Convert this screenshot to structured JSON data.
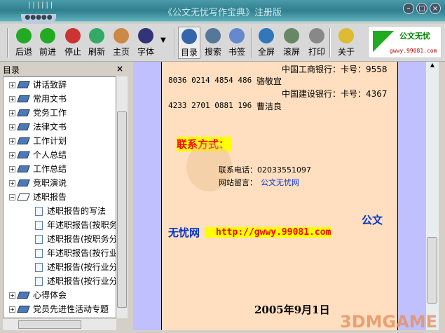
{
  "window": {
    "title": "《公文无忧写作宝典》注册版"
  },
  "toolbar": {
    "buttons": [
      {
        "label": "后退",
        "icon": "back-arrow-icon"
      },
      {
        "label": "前进",
        "icon": "forward-arrow-icon"
      },
      {
        "label": "停止",
        "icon": "stop-icon"
      },
      {
        "label": "刷新",
        "icon": "refresh-icon"
      },
      {
        "label": "主页",
        "icon": "home-icon"
      },
      {
        "label": "字体",
        "icon": "font-icon"
      },
      {
        "label": "目录",
        "icon": "contents-icon"
      },
      {
        "label": "搜索",
        "icon": "search-icon"
      },
      {
        "label": "书签",
        "icon": "bookmark-star-icon"
      },
      {
        "label": "全屏",
        "icon": "fullscreen-icon"
      },
      {
        "label": "滚屏",
        "icon": "autoscroll-icon"
      },
      {
        "label": "打印",
        "icon": "print-icon"
      },
      {
        "label": "关于",
        "icon": "about-cursor-icon"
      }
    ],
    "logo_text": "公文无忧",
    "logo_url": "gwwy.99081.com"
  },
  "sidebar": {
    "title": "目录",
    "close": "×",
    "items": [
      {
        "label": "讲话致辞",
        "type": "folder"
      },
      {
        "label": "常用文书",
        "type": "folder"
      },
      {
        "label": "党务工作",
        "type": "folder"
      },
      {
        "label": "法律文书",
        "type": "folder"
      },
      {
        "label": "工作计划",
        "type": "folder"
      },
      {
        "label": "个人总结",
        "type": "folder"
      },
      {
        "label": "工作总结",
        "type": "folder"
      },
      {
        "label": "竞职演说",
        "type": "folder"
      },
      {
        "label": "述职报告",
        "type": "open"
      },
      {
        "label": "述职报告的写法",
        "type": "doc"
      },
      {
        "label": "年述职报告(按职务",
        "type": "doc"
      },
      {
        "label": "述职报告(按职务分",
        "type": "doc"
      },
      {
        "label": "年述职报告(按行业",
        "type": "doc"
      },
      {
        "label": "述职报告(按行业分",
        "type": "doc"
      },
      {
        "label": "述职报告(按行业分",
        "type": "doc"
      },
      {
        "label": "心得体会",
        "type": "folder"
      },
      {
        "label": "党员先进性活动专题",
        "type": "folder"
      }
    ]
  },
  "document": {
    "bank1": "中国工商银行：卡号：9558",
    "acct1": "8036 0214 4854 486",
    "name1": "骆敬宜",
    "bank2": "中国建设银行：卡号：4367",
    "acct2": "4233 2701 0881 196",
    "name2": "曹洁良",
    "contact_heading": "联系方式：",
    "phone": "联系电话：02033551097",
    "msg_label": "网站留言：",
    "msg_link": "公文无忧网",
    "site1": "公文",
    "site2": "无忧网",
    "url": "http://gwwy.99081.com",
    "date": "2005年9月1日"
  },
  "watermark": "3DMGAME"
}
